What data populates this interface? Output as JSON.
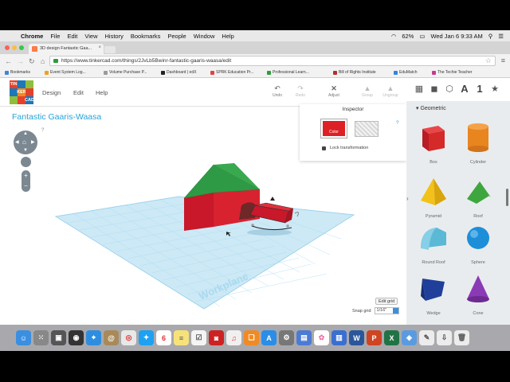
{
  "menubar": {
    "app": "Chrome",
    "items": [
      "File",
      "Edit",
      "View",
      "History",
      "Bookmarks",
      "People",
      "Window",
      "Help"
    ],
    "battery": "62%",
    "datetime": "Wed Jan 6  9:33 AM"
  },
  "browser": {
    "tab_title": "3D design Fantastic Gaa...",
    "url": "https://www.tinkercad.com/things/2JvLb5Bwinr-fantastic-gaaris-waasa/edit",
    "bookmarks": [
      {
        "label": "Bookmarks",
        "color": "#3c86d8"
      },
      {
        "label": "Event System Log...",
        "color": "#f0a020"
      },
      {
        "label": "Volume Purchase P...",
        "color": "#9a9a9a"
      },
      {
        "label": "Dashboard | edX",
        "color": "#222222"
      },
      {
        "label": "SPRK Education Pr...",
        "color": "#e64040"
      },
      {
        "label": "Professional Learn...",
        "color": "#2a9d3a"
      },
      {
        "label": "Bill of Rights Institute",
        "color": "#b33030"
      },
      {
        "label": "EduMatch",
        "color": "#2e86de"
      },
      {
        "label": "The Techie Teacher",
        "color": "#c83a8c"
      }
    ]
  },
  "tinkercad": {
    "logo_letters": [
      "TIN",
      "KER",
      "CAD"
    ],
    "menu": [
      "Design",
      "Edit",
      "Help"
    ],
    "toolbar": [
      {
        "label": "Undo",
        "icon": "undo-icon",
        "glyph": "↶",
        "enabled": true
      },
      {
        "label": "Redo",
        "icon": "redo-icon",
        "glyph": "↷",
        "enabled": false
      },
      {
        "label": "Adjust",
        "icon": "adjust-icon",
        "glyph": "✕",
        "enabled": true
      },
      {
        "label": "Group",
        "icon": "group-icon",
        "glyph": "▲",
        "enabled": false
      },
      {
        "label": "Ungroup",
        "icon": "ungroup-icon",
        "glyph": "▲",
        "enabled": false
      }
    ],
    "view_number": "1",
    "design_title": "Fantastic Gaaris-Waasa",
    "workplane_label": "Workplane",
    "edit_grid": "Edit grid",
    "snap_grid_label": "Snap grid",
    "snap_grid_value": "1/16\""
  },
  "inspector": {
    "title": "Inspector",
    "color_label": "Color",
    "color": "#dd2026",
    "lock_label": "Lock transformation"
  },
  "shapes_panel": {
    "category": "Geometric",
    "shapes": [
      {
        "label": "Box",
        "color": "#d42a2a"
      },
      {
        "label": "Cylinder",
        "color": "#e8851f"
      },
      {
        "label": "Pyramid",
        "color": "#f2c21a"
      },
      {
        "label": "Roof",
        "color": "#3ea63e"
      },
      {
        "label": "Round Roof",
        "color": "#5bb9d6"
      },
      {
        "label": "Sphere",
        "color": "#1d8fd8"
      },
      {
        "label": "Wedge",
        "color": "#1f3f9a"
      },
      {
        "label": "Cone",
        "color": "#8a3ab5"
      }
    ]
  },
  "dock": [
    "Finder",
    "Launchpad",
    "Mission Control",
    "Dashboard",
    "Safari",
    "Contacts",
    "Chrome",
    "Twitter",
    "Calendar",
    "Notes",
    "Reminders",
    "Photo Booth",
    "iTunes",
    "iBooks",
    "App Store",
    "System Preferences",
    "Preview",
    "Photos",
    "Keynote",
    "Word",
    "PowerPoint",
    "Excel",
    "Maps",
    "TextEdit",
    "Downloads",
    "Trash"
  ]
}
